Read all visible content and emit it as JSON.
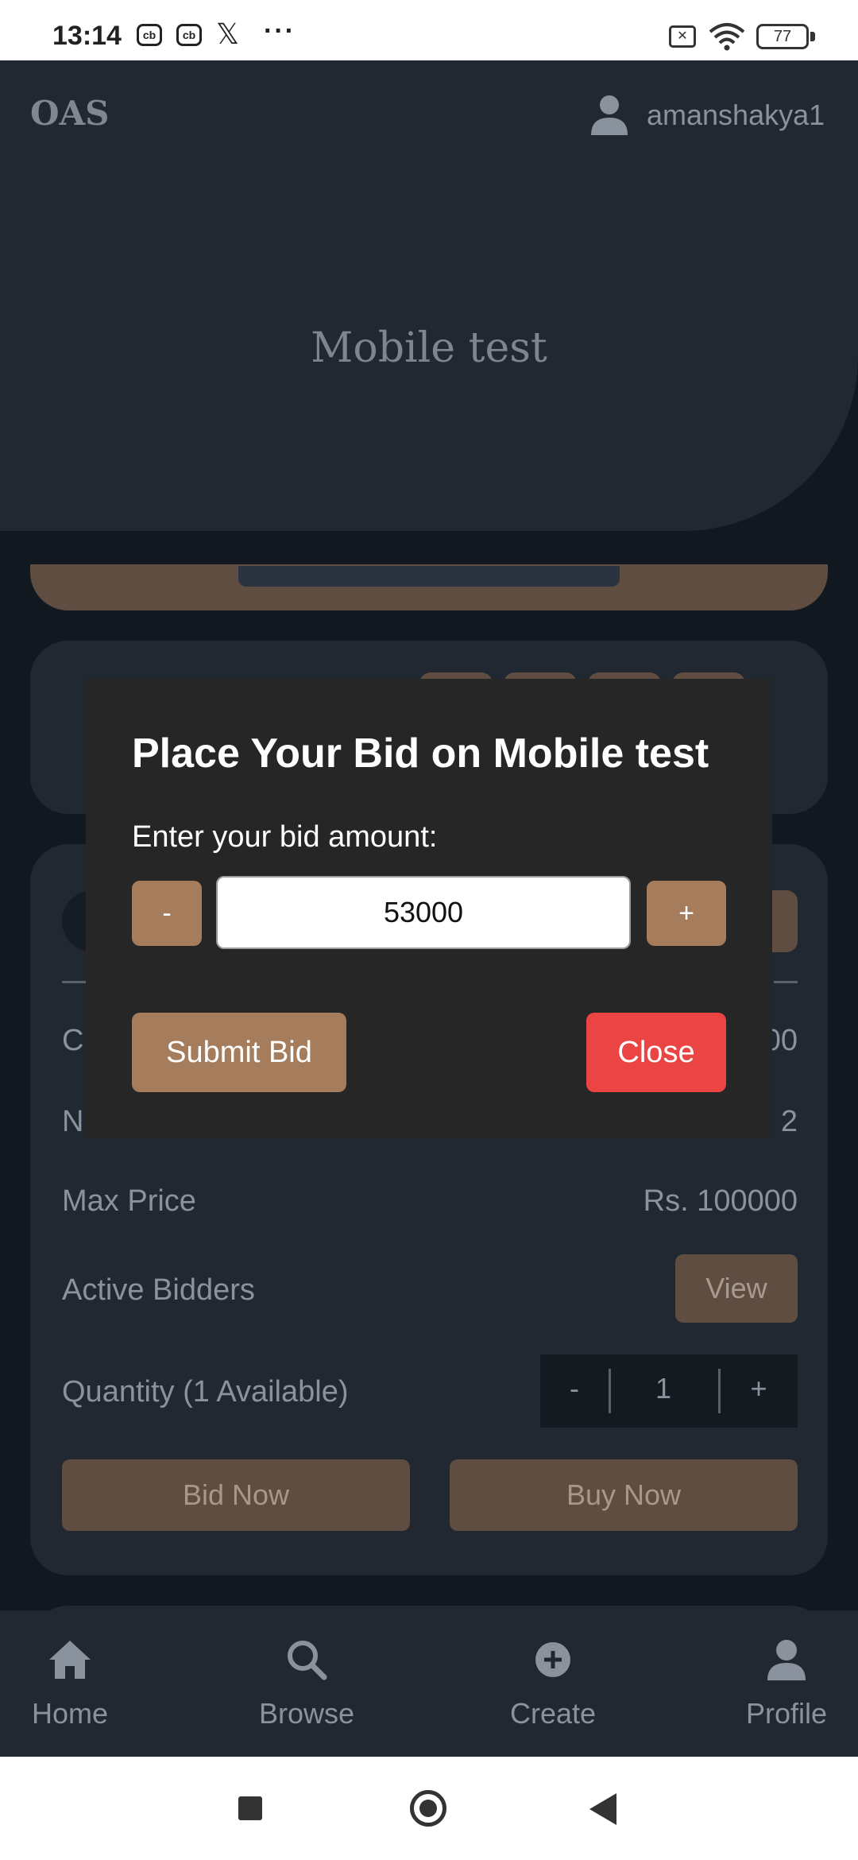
{
  "status_bar": {
    "time": "13:14",
    "app_icon_1": "cb",
    "app_icon_2": "cb",
    "x_icon": "𝕏",
    "more": "···",
    "sim_icon": "sim-off-icon",
    "battery": "77"
  },
  "header": {
    "brand": "OAS",
    "username": "amanshakya1",
    "title": "Mobile test"
  },
  "details": {
    "row_current_label": "C",
    "row_current_value": "00",
    "row_next_label": "N",
    "row_next_value": "2",
    "max_price_label": "Max Price",
    "max_price_value": "Rs. 100000",
    "active_bidders_label": "Active Bidders",
    "view_label": "View",
    "quantity_label": "Quantity (1 Available)",
    "qty_minus": "-",
    "qty_value": "1",
    "qty_plus": "+",
    "bid_now_label": "Bid Now",
    "buy_now_label": "Buy Now"
  },
  "dialog": {
    "title": "Place Your Bid on Mobile test",
    "prompt": "Enter your bid amount:",
    "minus_label": "-",
    "plus_label": "+",
    "bid_value": "53000",
    "submit_label": "Submit Bid",
    "close_label": "Close"
  },
  "bottom_nav": {
    "items": [
      {
        "label": "Home",
        "icon": "home-icon"
      },
      {
        "label": "Browse",
        "icon": "search-icon"
      },
      {
        "label": "Create",
        "icon": "plus-circle-icon"
      },
      {
        "label": "Profile",
        "icon": "user-icon"
      }
    ]
  },
  "colors": {
    "background": "#121820",
    "card": "#222831",
    "accent": "#a57c5c",
    "close": "#ea4444",
    "dialog": "#262626"
  }
}
